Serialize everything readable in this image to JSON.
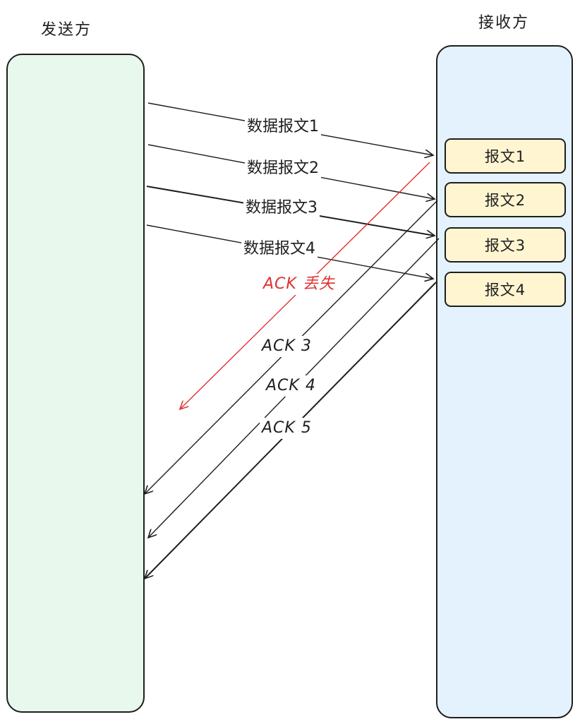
{
  "diagram": {
    "sender_title": "发送方",
    "receiver_title": "接收方",
    "received_packets": [
      "报文1",
      "报文2",
      "报文3",
      "报文4"
    ],
    "data_messages": [
      "数据报文1",
      "数据报文2",
      "数据报文3",
      "数据报文4"
    ],
    "acks": {
      "lost": "ACK 丢失",
      "ack3": "ACK 3",
      "ack4": "ACK 4",
      "ack5": "ACK 5"
    },
    "colors": {
      "sender_fill": "#e8f8ec",
      "receiver_fill": "#e3f2fd",
      "packet_fill": "#fff5d1",
      "lost_ack": "#e03131",
      "stroke": "#1e1e1e"
    }
  }
}
